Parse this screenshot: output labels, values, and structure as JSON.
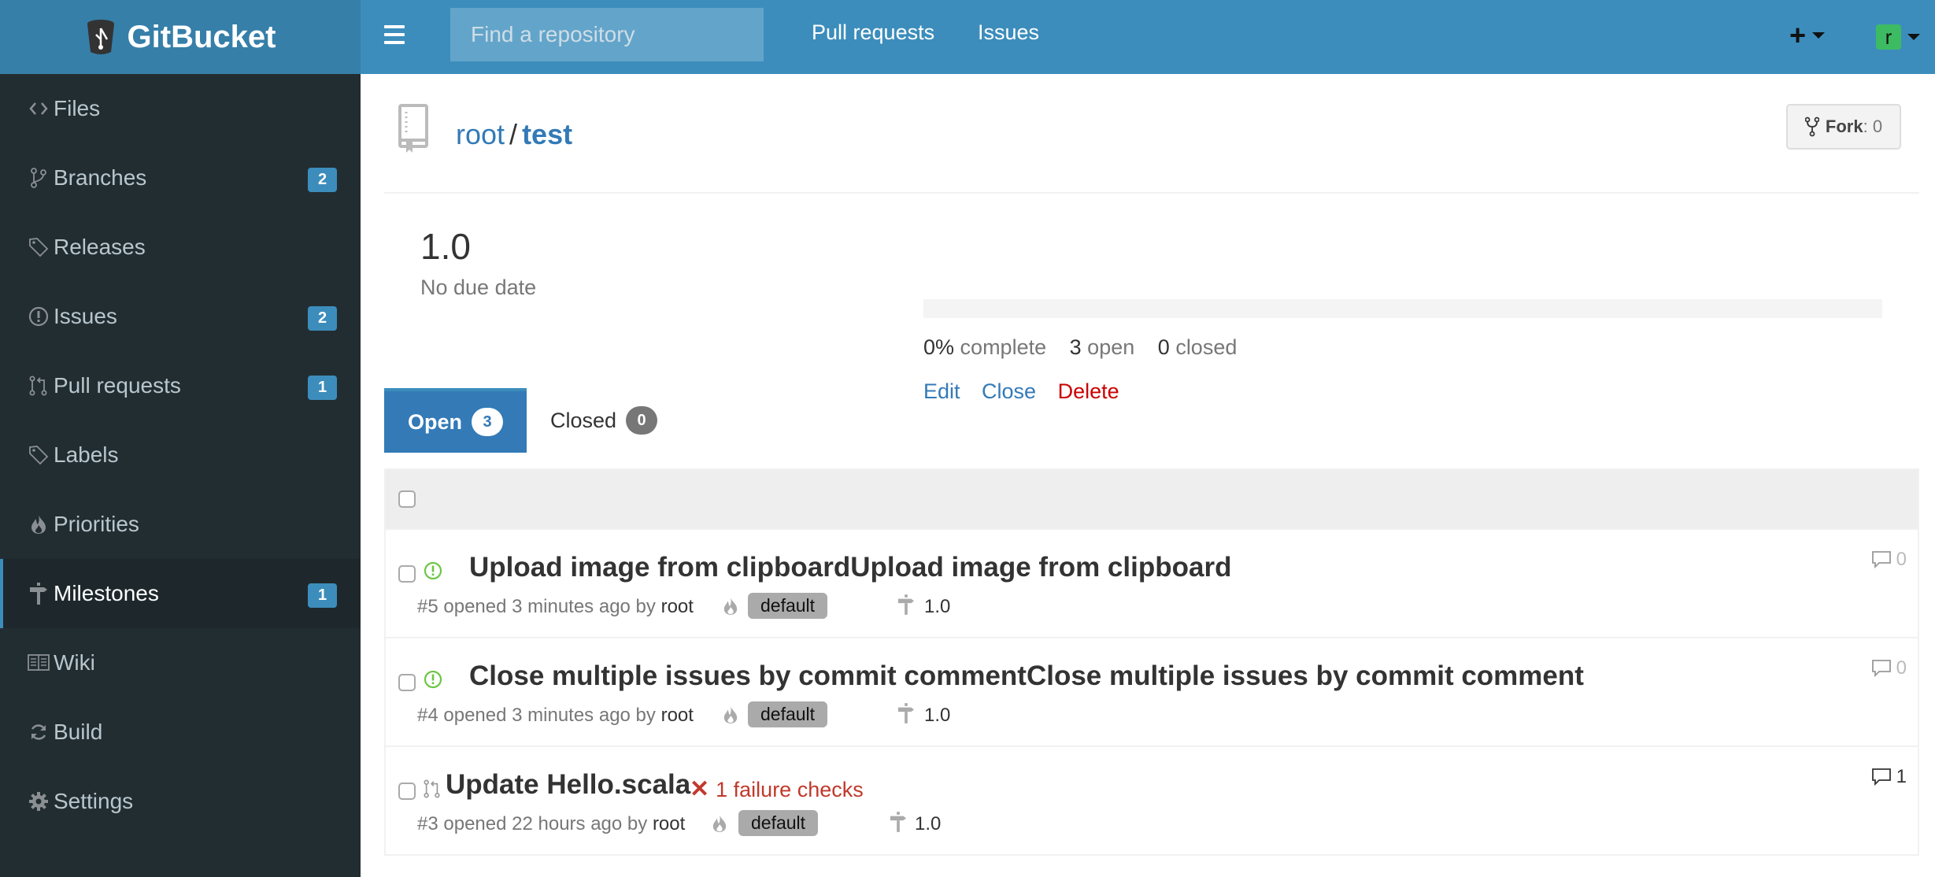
{
  "header": {
    "logo_text": "GitBucket",
    "search_placeholder": "Find a repository",
    "nav": [
      "Pull requests",
      "Issues"
    ],
    "plus_label": "+",
    "user_initial": "r"
  },
  "sidebar": {
    "items": [
      {
        "label": "Files",
        "icon": "code-icon",
        "badge": null
      },
      {
        "label": "Branches",
        "icon": "git-branch-icon",
        "badge": "2"
      },
      {
        "label": "Releases",
        "icon": "tag-icon",
        "badge": null
      },
      {
        "label": "Issues",
        "icon": "issue-opened-icon",
        "badge": "2"
      },
      {
        "label": "Pull requests",
        "icon": "git-pull-request-icon",
        "badge": "1"
      },
      {
        "label": "Labels",
        "icon": "tag-icon",
        "badge": null
      },
      {
        "label": "Priorities",
        "icon": "flame-icon",
        "badge": null
      },
      {
        "label": "Milestones",
        "icon": "milestone-icon",
        "badge": "1",
        "active": true
      },
      {
        "label": "Wiki",
        "icon": "book-icon",
        "badge": null
      },
      {
        "label": "Build",
        "icon": "sync-icon",
        "badge": null
      },
      {
        "label": "Settings",
        "icon": "gear-icon",
        "badge": null
      }
    ]
  },
  "repo": {
    "owner": "root",
    "separator": "/",
    "name": "test",
    "fork_label": "Fork",
    "fork_count": ": 0"
  },
  "milestone": {
    "title": "1.0",
    "due": "No due date",
    "progress_percent": 0,
    "complete_value": "0%",
    "complete_label": "complete",
    "open_value": "3",
    "open_label": "open",
    "closed_value": "0",
    "closed_label": "closed",
    "actions": {
      "edit": "Edit",
      "close": "Close",
      "delete": "Delete"
    }
  },
  "tabs": [
    {
      "label": "Open",
      "count": "3",
      "active": true
    },
    {
      "label": "Closed",
      "count": "0",
      "active": false
    }
  ],
  "issues": [
    {
      "type": "issue",
      "title": "Upload image from clipboardUpload image from clipboard",
      "number": "#5",
      "opened": "opened 3 minutes ago by",
      "author": "root",
      "priority": "default",
      "milestone": "1.0",
      "comments": "0",
      "failure": null
    },
    {
      "type": "issue",
      "title": "Close multiple issues by commit commentClose multiple issues by commit comment",
      "number": "#4",
      "opened": "opened 3 minutes ago by",
      "author": "root",
      "priority": "default",
      "milestone": "1.0",
      "comments": "0",
      "failure": null
    },
    {
      "type": "pull-request",
      "title": "Update Hello.scala",
      "number": "#3",
      "opened": "opened 22 hours ago by",
      "author": "root",
      "priority": "default",
      "milestone": "1.0",
      "comments": "1",
      "failure": "1 failure checks"
    }
  ],
  "colors": {
    "brand": "#3c8dbc",
    "sidebar_bg": "#222d32",
    "link": "#337ab7",
    "danger": "#cc0000",
    "open_issue": "#6cc644"
  }
}
